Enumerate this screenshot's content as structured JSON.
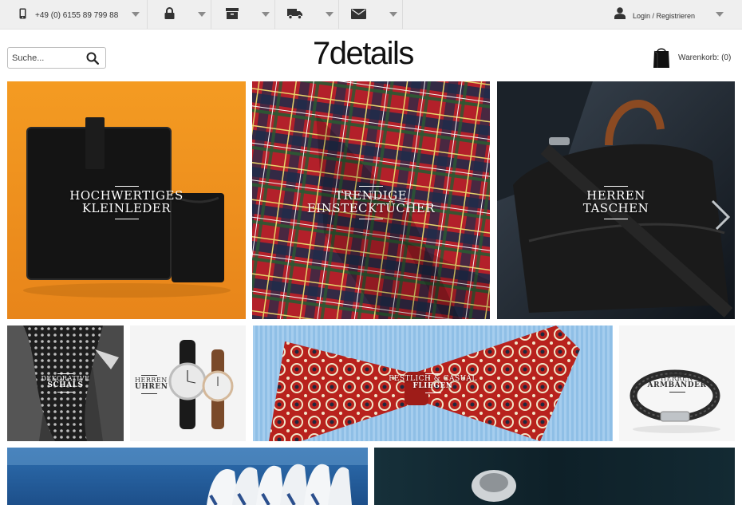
{
  "topbar": {
    "phone": "+49 (0) 6155 89 799 88",
    "login": "Login / Registrieren"
  },
  "search": {
    "placeholder": "Suche..."
  },
  "logo": "7details",
  "cart": {
    "label": "Warenkorb: (0)"
  },
  "tiles": [
    {
      "line1": "HOCHWERTIGES",
      "line2": "KLEINLEDER"
    },
    {
      "line1": "TRENDIGE",
      "line2": "EINSTECKTÜCHER"
    },
    {
      "line1": "HERREN",
      "line2": "TASCHEN"
    },
    {
      "line1": "DEKORATIVE",
      "line2": "SCHALS"
    },
    {
      "line1": "HERREN",
      "line2": "UHREN"
    },
    {
      "line1": "FESTLICH & CASUAL",
      "line2": "FLIEGEN"
    },
    {
      "line1": "HERREN",
      "line2": "ARMBÄNDER"
    }
  ],
  "colors": {
    "topbar": "#efefef",
    "orange": "#f0931e",
    "tartan_red": "#b01d25"
  }
}
